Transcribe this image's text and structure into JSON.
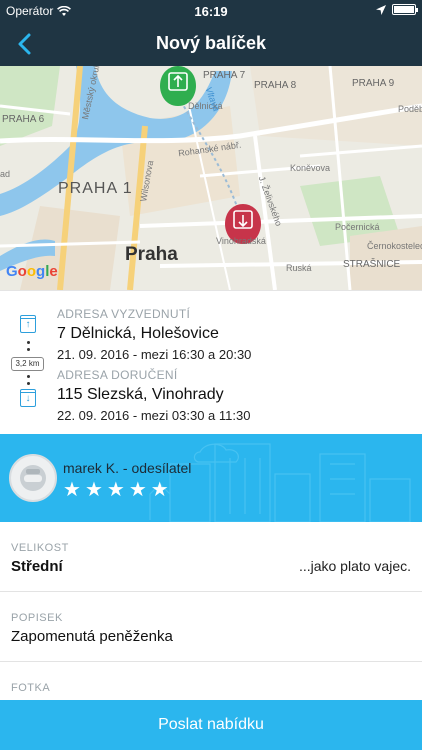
{
  "status_bar": {
    "carrier": "Operátor",
    "time": "16:19"
  },
  "nav": {
    "title": "Nový balíček",
    "back_icon": "chevron-left-icon"
  },
  "map": {
    "labels": {
      "praha1": "PRAHA 1",
      "praha": "Praha",
      "praha6": "PRAHA 6",
      "praha7": "PRAHA 7",
      "praha8": "PRAHA 8",
      "praha9": "PRAHA 9",
      "strasnice": "STRAŠNICE",
      "vltava": "Vltava",
      "delnicka": "Dělnická",
      "rohanske": "Rohanské nábř.",
      "wilsonova": "Wilsonova",
      "konevova": "Koněvova",
      "pocernicka": "Počernická",
      "cernokostelecka": "Černokostelec",
      "vinohradska": "Vinohradská",
      "ruska": "Ruská",
      "zelivskeho": "J. Želivského",
      "mestsky": "Městský okruh",
      "podebr": "Poděb",
      "left_edge": "ad",
      "google": "Google"
    }
  },
  "route": {
    "pickup_label": "ADRESA VYZVEDNUTÍ",
    "pickup_street": "7 Dělnická, Holešovice",
    "pickup_time": "21. 09. 2016 - mezi 16:30 a 20:30",
    "distance": "3,2 km",
    "delivery_label": "ADRESA DORUČENÍ",
    "delivery_street": "115 Slezská, Vinohrady",
    "delivery_time": "22. 09. 2016 - mezi 03:30 a 11:30"
  },
  "sender": {
    "name": "marek K. - odesílatel",
    "rating": 5,
    "stars": [
      "★",
      "★",
      "★",
      "★",
      "★"
    ]
  },
  "size": {
    "label": "VELIKOST",
    "value": "Střední",
    "note": "...jako plato vajec."
  },
  "description": {
    "label": "POPISEK",
    "value": "Zapomenutá peněženka"
  },
  "photo": {
    "label": "FOTKA"
  },
  "cta": {
    "label": "Poslat nabídku"
  },
  "colors": {
    "nav_bg": "#1f3543",
    "accent": "#2bb6ee",
    "pickup_pin": "#2fae4f",
    "delivery_pin": "#c7344a"
  }
}
